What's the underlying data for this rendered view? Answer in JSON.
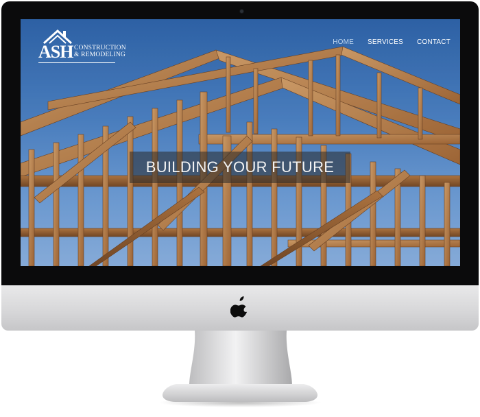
{
  "site": {
    "logo": {
      "name": "ASH",
      "line1": "CONSTRUCTION",
      "line2": "& REMODELING"
    },
    "nav": [
      {
        "label": "HOME",
        "active": true
      },
      {
        "label": "SERVICES",
        "active": false
      },
      {
        "label": "CONTACT",
        "active": false
      }
    ],
    "hero": {
      "title": "BUILDING YOUR FUTURE"
    }
  },
  "device": {
    "brand_icon": "apple-logo-icon"
  },
  "colors": {
    "bezel": "#0b0b0c",
    "sky": "#4d84c6",
    "wood": "#c98a4b",
    "nav_active": "#bcd4ee"
  }
}
